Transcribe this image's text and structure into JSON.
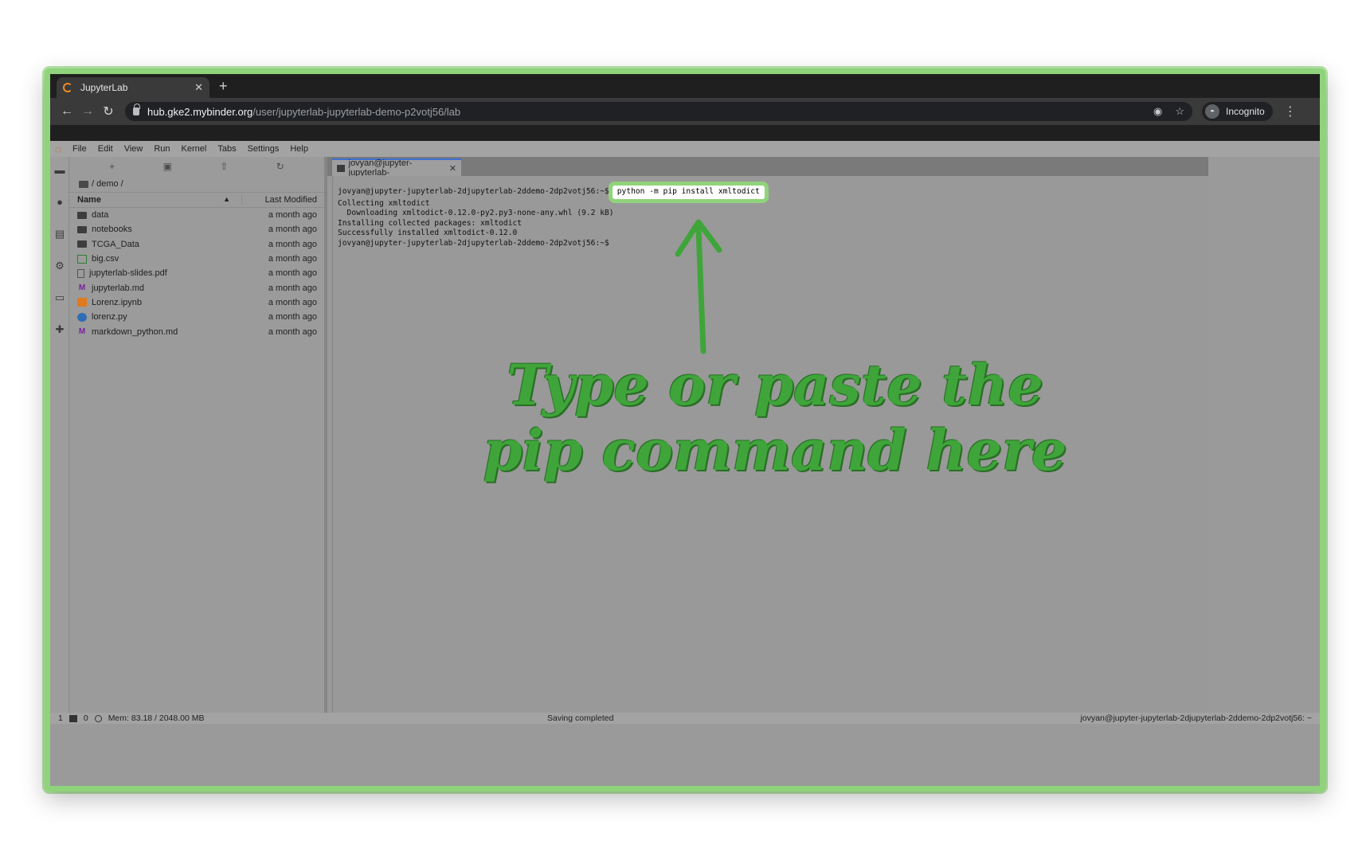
{
  "browser": {
    "tab_title": "JupyterLab",
    "url_host": "hub.gke2.mybinder.org",
    "url_path": "/user/jupyterlab-jupyterlab-demo-p2votj56/lab",
    "incognito_label": "Incognito"
  },
  "menu": [
    "File",
    "Edit",
    "View",
    "Run",
    "Kernel",
    "Tabs",
    "Settings",
    "Help"
  ],
  "filebrowser": {
    "breadcrumb": "/ demo /",
    "col_name": "Name",
    "col_modified": "Last Modified",
    "files": [
      {
        "name": "data",
        "type": "folder",
        "modified": "a month ago"
      },
      {
        "name": "notebooks",
        "type": "folder",
        "modified": "a month ago"
      },
      {
        "name": "TCGA_Data",
        "type": "folder",
        "modified": "a month ago"
      },
      {
        "name": "big.csv",
        "type": "csv",
        "modified": "a month ago"
      },
      {
        "name": "jupyterlab-slides.pdf",
        "type": "pdf",
        "modified": "a month ago"
      },
      {
        "name": "jupyterlab.md",
        "type": "md",
        "modified": "a month ago"
      },
      {
        "name": "Lorenz.ipynb",
        "type": "ipynb",
        "modified": "a month ago"
      },
      {
        "name": "lorenz.py",
        "type": "py",
        "modified": "a month ago"
      },
      {
        "name": "markdown_python.md",
        "type": "md",
        "modified": "a month ago"
      }
    ]
  },
  "terminal": {
    "tab_label": "jovyan@jupyter-jupyterlab-",
    "prompt": "jovyan@jupyter-jupyterlab-2djupyterlab-2ddemo-2dp2votj56:~$",
    "command": "python -m pip install xmltodict",
    "output": [
      "Collecting xmltodict",
      "  Downloading xmltodict-0.12.0-py2.py3-none-any.whl (9.2 kB)",
      "Installing collected packages: xmltodict",
      "Successfully installed xmltodict-0.12.0"
    ],
    "final_prompt": "jovyan@jupyter-jupyterlab-2djupyterlab-2ddemo-2dp2votj56:~$"
  },
  "annotation": {
    "line1": "Type or paste the",
    "line2": "pip command here",
    "color": "#3fa53a"
  },
  "statusbar": {
    "kernels": "1",
    "terminals": "0",
    "memory": "Mem: 83.18 / 2048.00 MB",
    "status": "Saving completed",
    "right": "jovyan@jupyter-jupyterlab-2djupyterlab-2ddemo-2dp2votj56: ~"
  }
}
